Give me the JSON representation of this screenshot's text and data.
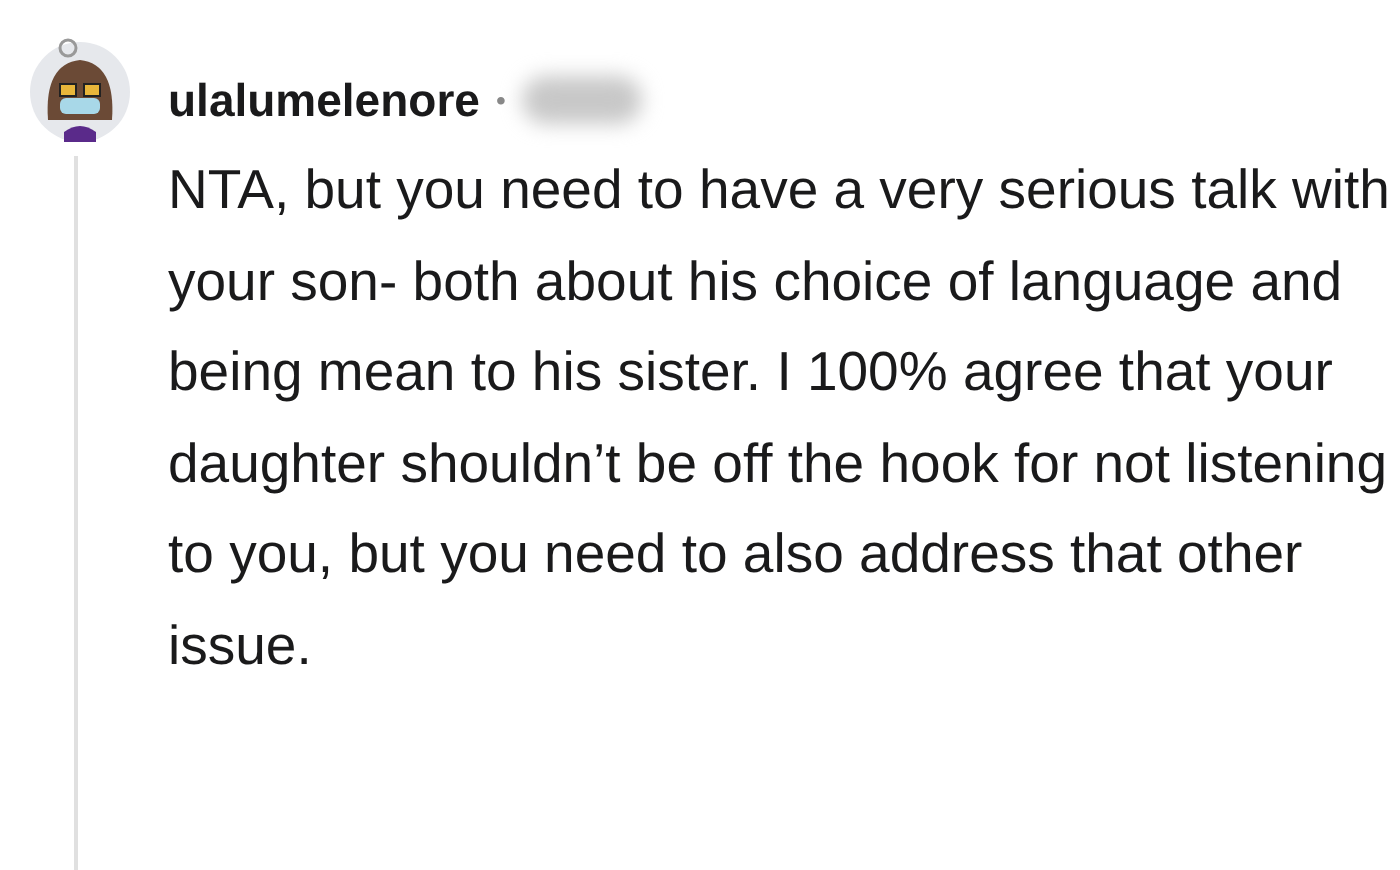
{
  "comment": {
    "username": "ulalumelenore",
    "separator": "•",
    "body": "NTA, but you need to have a very serious talk with your son- both about his choice of language and being mean to his sister. I 100% agree that your daughter shouldn’t be off the hook for not listening to you, but you need to also address that other issue."
  }
}
